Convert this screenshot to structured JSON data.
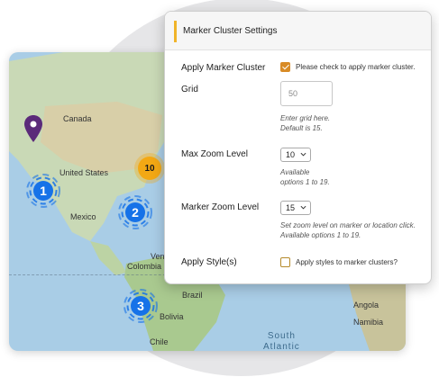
{
  "map": {
    "labels": {
      "canada": "Canada",
      "united_states": "United States",
      "mexico": "Mexico",
      "colombia": "Colombia",
      "vene": "Vene",
      "brazil": "Brazil",
      "bolivia": "Bolivia",
      "chile": "Chile",
      "angola": "Angola",
      "namibia": "Namibia",
      "south_atlantic": "South\nAtlantic"
    },
    "clusters": [
      {
        "count": "1",
        "color": "#1672e8"
      },
      {
        "count": "2",
        "color": "#1672e8"
      },
      {
        "count": "3",
        "color": "#1672e8"
      }
    ],
    "small_cluster": {
      "count": "10",
      "color": "#f3a814"
    },
    "pin_color": "#5b2a7a"
  },
  "settings": {
    "title": "Marker Cluster Settings",
    "apply_cluster": {
      "label": "Apply Marker Cluster",
      "checked": true,
      "check_text": "Please check to apply marker cluster."
    },
    "grid": {
      "label": "Grid",
      "value": "50",
      "desc_line1": "Enter grid here.",
      "desc_line2": "Default is 15."
    },
    "max_zoom": {
      "label": "Max Zoom Level",
      "value": "10",
      "desc_line1": "Available",
      "desc_line2": "options 1 to 19."
    },
    "marker_zoom": {
      "label": "Marker Zoom Level",
      "value": "15",
      "desc_line1": "Set zoom level on marker or location click.",
      "desc_line2": "Available options 1 to 19."
    },
    "apply_style": {
      "label": "Apply Style(s)",
      "checked": false,
      "check_text": "Apply styles to marker clusters?"
    }
  }
}
